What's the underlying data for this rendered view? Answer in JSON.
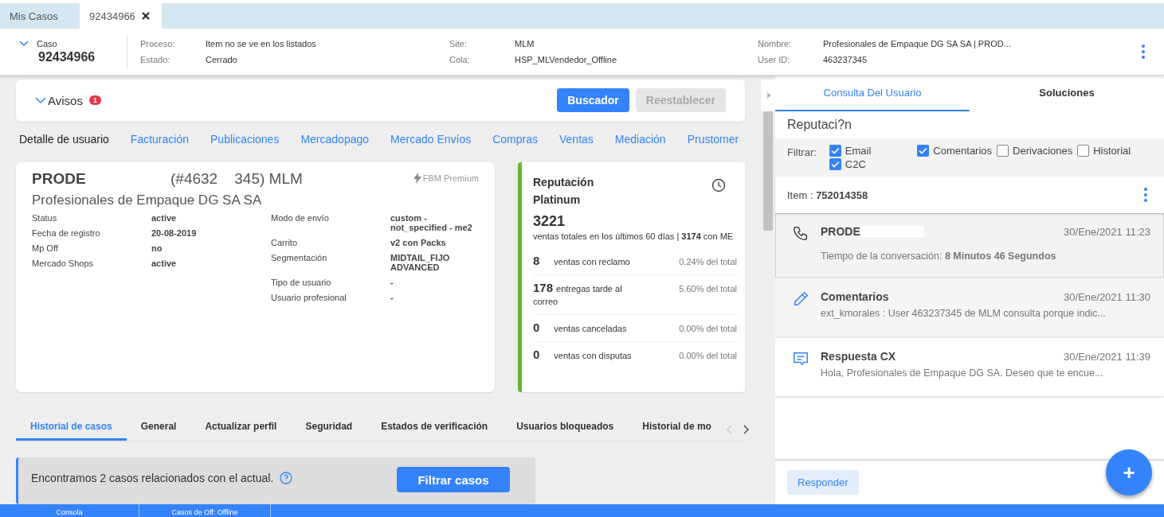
{
  "tabs": [
    {
      "label": "Mis Casos",
      "selected": false,
      "closable": false
    },
    {
      "label": "92434966",
      "selected": true,
      "closable": true
    }
  ],
  "case_header": {
    "case_label": "Caso",
    "case_number": "92434966",
    "fields": [
      {
        "label": "Proceso:",
        "value": "Item no se ve en los listados"
      },
      {
        "label": "Estado:",
        "value": "Cerrado"
      },
      {
        "label": "Site:",
        "value": "MLM"
      },
      {
        "label": "Cola:",
        "value": "HSP_MLVendedor_Offline"
      },
      {
        "label": "Nombre:",
        "value": "Profesionales de Empaque DG SA SA | PROD..."
      },
      {
        "label": "User ID:",
        "value": "463237345"
      }
    ]
  },
  "avisos": {
    "title": "Avisos",
    "badge": "1",
    "buttons": [
      {
        "label": "Buscador",
        "disabled": false
      },
      {
        "label": "Reestablecer",
        "disabled": true
      }
    ]
  },
  "nav_links": [
    {
      "label": "Detalle de usuario",
      "selected": true
    },
    {
      "label": "Facturación",
      "selected": false
    },
    {
      "label": "Publicaciones",
      "selected": false
    },
    {
      "label": "Mercadopago",
      "selected": false
    },
    {
      "label": "Mercado Envíos",
      "selected": false
    },
    {
      "label": "Compras",
      "selected": false
    },
    {
      "label": "Ventas",
      "selected": false
    },
    {
      "label": "Mediación",
      "selected": false
    },
    {
      "label": "Prustomer",
      "selected": false
    }
  ],
  "user_card": {
    "nickname": "PRODE",
    "id_site": "(#4632    345) MLM",
    "badge": "FBM Premium",
    "name": "Profesionales de Empaque DG SA SA",
    "left_fields": [
      {
        "label": "Status",
        "value": "active"
      },
      {
        "label": "Fecha de registro",
        "value": "20-08-2019"
      },
      {
        "label": "Mp Off",
        "value": "no"
      },
      {
        "label": "Mercado Shops",
        "value": "active"
      }
    ],
    "right_fields": [
      {
        "label": "Modo de envío",
        "value": "custom - not_specified - me2"
      },
      {
        "label": "Carrito",
        "value": "v2 con Packs"
      },
      {
        "label": "Segmentación",
        "value": "MIDTAIL_FIJO ADVANCED"
      },
      {
        "label": "Tipo de usuario",
        "value": "-"
      },
      {
        "label": "Usuario profesional",
        "value": "-"
      }
    ]
  },
  "reputation": {
    "title": "Reputación Platinum",
    "color": "#6ab42d",
    "total": "3221",
    "total_text": "ventas totales en los últimos 60 días | **3174** con ME",
    "stats": [
      {
        "count": "8",
        "label": "ventas con reclamo",
        "percent": "0.24% del total"
      },
      {
        "count": "178",
        "label": "entregas tarde al correo",
        "percent": "5.60% del total"
      },
      {
        "count": "0",
        "label": "ventas canceladas",
        "percent": "0.00% del total"
      },
      {
        "count": "0",
        "label": "ventas con disputas",
        "percent": "0.00% del total"
      }
    ]
  },
  "bottom_tabs": [
    {
      "label": "Historial de casos",
      "selected": true
    },
    {
      "label": "General",
      "selected": false
    },
    {
      "label": "Actualizar perfil",
      "selected": false
    },
    {
      "label": "Seguridad",
      "selected": false
    },
    {
      "label": "Estados de verificación",
      "selected": false
    },
    {
      "label": "Usuarios bloqueados",
      "selected": false
    },
    {
      "label": "Historial de mo",
      "selected": false
    }
  ],
  "related": {
    "text": "Encontramos 2 casos relacionados con el actual.",
    "button": "Filtrar casos"
  },
  "right_panel": {
    "tabs": [
      {
        "label": "Consulta Del Usuario",
        "selected": true
      },
      {
        "label": "Soluciones",
        "selected": false
      }
    ],
    "topic": "Reputaci?n",
    "filter_label": "Filtrar:",
    "filters": [
      {
        "label": "Email",
        "checked": true
      },
      {
        "label": "Comentarios",
        "checked": true
      },
      {
        "label": "Derivaciones",
        "checked": false
      },
      {
        "label": "Historial",
        "checked": false
      },
      {
        "label": "C2C",
        "checked": true
      }
    ],
    "item": "Item : **752014358**",
    "messages": [
      {
        "kind": "call",
        "title": "PRODE",
        "date": "30/Ene/2021 11:23",
        "text": "Tiempo de la conversación: **8 Minutos 46 Segundos**",
        "selected": true,
        "redacted": true
      },
      {
        "kind": "comment",
        "title": "Comentarios",
        "date": "30/Ene/2021 11:30",
        "text": "ext_kmorales : User 463237345 de MLM consulta porque indic...",
        "selected": false,
        "redacted": false
      },
      {
        "kind": "reply",
        "title": "Respuesta CX",
        "date": "30/Ene/2021 11:39",
        "text": "Hola, Profesionales de Empaque DG SA.   Deseo que te encue...",
        "selected": false,
        "redacted": false
      }
    ],
    "reply_button": "Responder",
    "fab": "+"
  },
  "footer_tabs": [
    "Consola",
    "Casos de Off: Offline"
  ]
}
